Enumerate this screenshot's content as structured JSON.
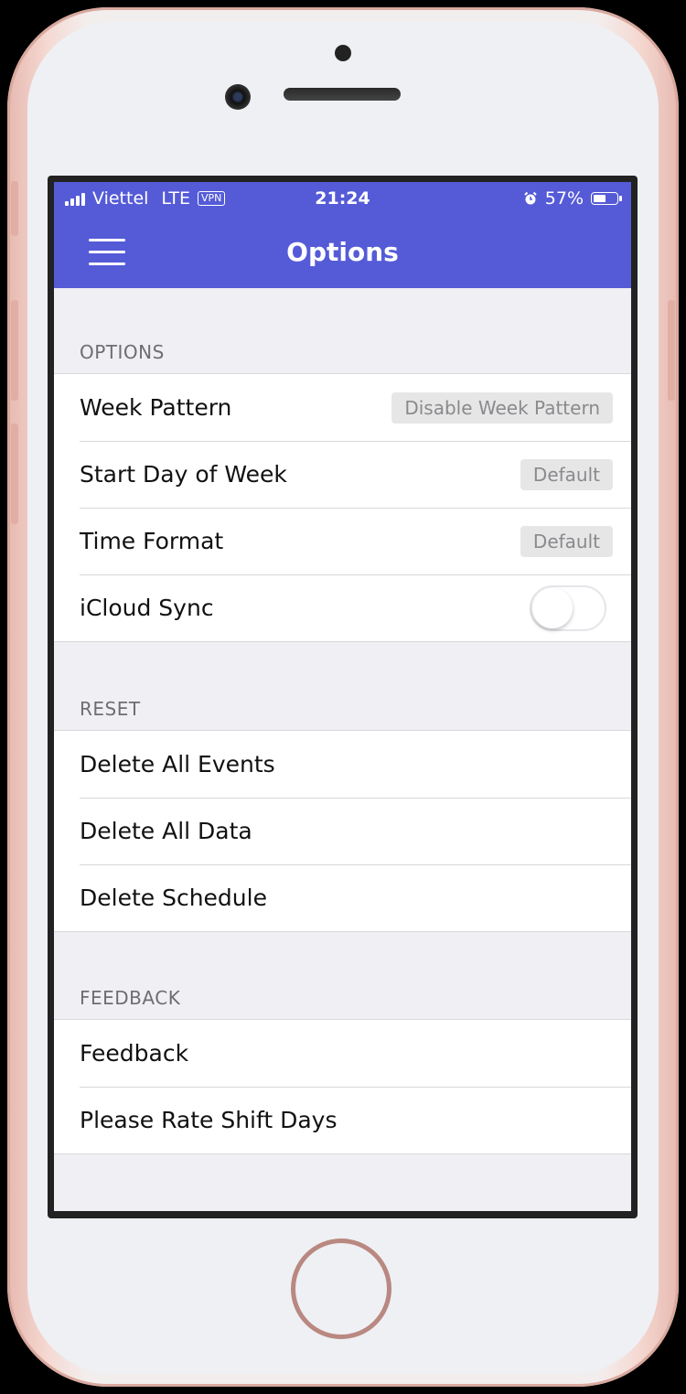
{
  "status_bar": {
    "carrier": "Viettel",
    "network": "LTE",
    "vpn": "VPN",
    "time": "21:24",
    "battery_pct": "57%",
    "battery_level": 0.57
  },
  "nav": {
    "title": "Options"
  },
  "sections": {
    "options": {
      "header": "OPTIONS",
      "week_pattern": {
        "label": "Week Pattern",
        "value": "Disable Week Pattern"
      },
      "start_day": {
        "label": "Start Day of Week",
        "value": "Default"
      },
      "time_format": {
        "label": "Time Format",
        "value": "Default"
      },
      "icloud_sync": {
        "label": "iCloud Sync",
        "enabled": false
      }
    },
    "reset": {
      "header": "RESET",
      "items": [
        "Delete All Events",
        "Delete All Data",
        "Delete Schedule"
      ]
    },
    "feedback": {
      "header": "FEEDBACK",
      "items": [
        "Feedback",
        "Please Rate Shift Days"
      ]
    }
  },
  "colors": {
    "accent": "#555bd7",
    "background": "#efeff4"
  }
}
